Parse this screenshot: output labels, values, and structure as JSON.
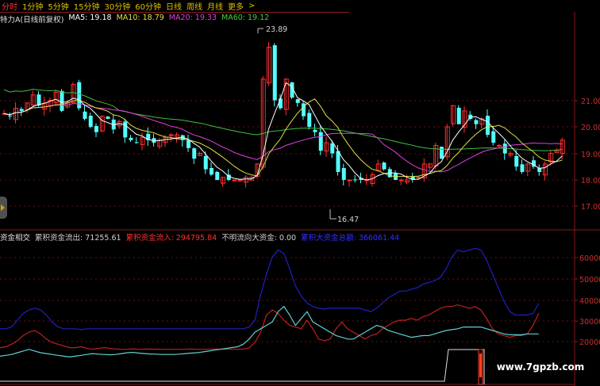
{
  "tabs": [
    {
      "label": "分时",
      "active": true
    },
    {
      "label": "1分钟",
      "active": false
    },
    {
      "label": "5分钟",
      "active": false
    },
    {
      "label": "15分钟",
      "active": false
    },
    {
      "label": "30分钟",
      "active": false
    },
    {
      "label": "60分钟",
      "active": false
    },
    {
      "label": "日线",
      "active": false
    },
    {
      "label": "周线",
      "active": false
    },
    {
      "label": "月线",
      "active": false
    },
    {
      "label": "更多",
      "active": false
    }
  ],
  "tabs_arrow": ">",
  "main_legend": {
    "name": "特力A(日线前复权)",
    "ma5": "MA5: 19.18",
    "ma10": "MA10: 18.79",
    "ma20": "MA20: 19.33",
    "ma60": "MA60: 19.12"
  },
  "sub_legend": {
    "name": "资金相交",
    "out": "累积资金流出: 71255.61",
    "in": "累积资金流入: 294795.84",
    "unknown": "不明流向大资金: 0.00",
    "big": "累积大资金总额: 366061.44"
  },
  "price_axis": [
    "21.00",
    "20.00",
    "19.00",
    "18.00",
    "17.00"
  ],
  "volume_axis": [
    "60000",
    "50000",
    "40000",
    "30000",
    "20000"
  ],
  "annotations": {
    "high": "23.89",
    "low": "16.47"
  },
  "watermark": "www.7gpzb.com",
  "colors": {
    "up": "#ff3030",
    "down": "#54ffff",
    "ma5": "#ffffff",
    "ma10": "#e0e040",
    "ma20": "#e040e0",
    "ma60": "#40c040",
    "big": "#2020c0",
    "in": "#c02020",
    "out": "#60d0d0"
  }
}
